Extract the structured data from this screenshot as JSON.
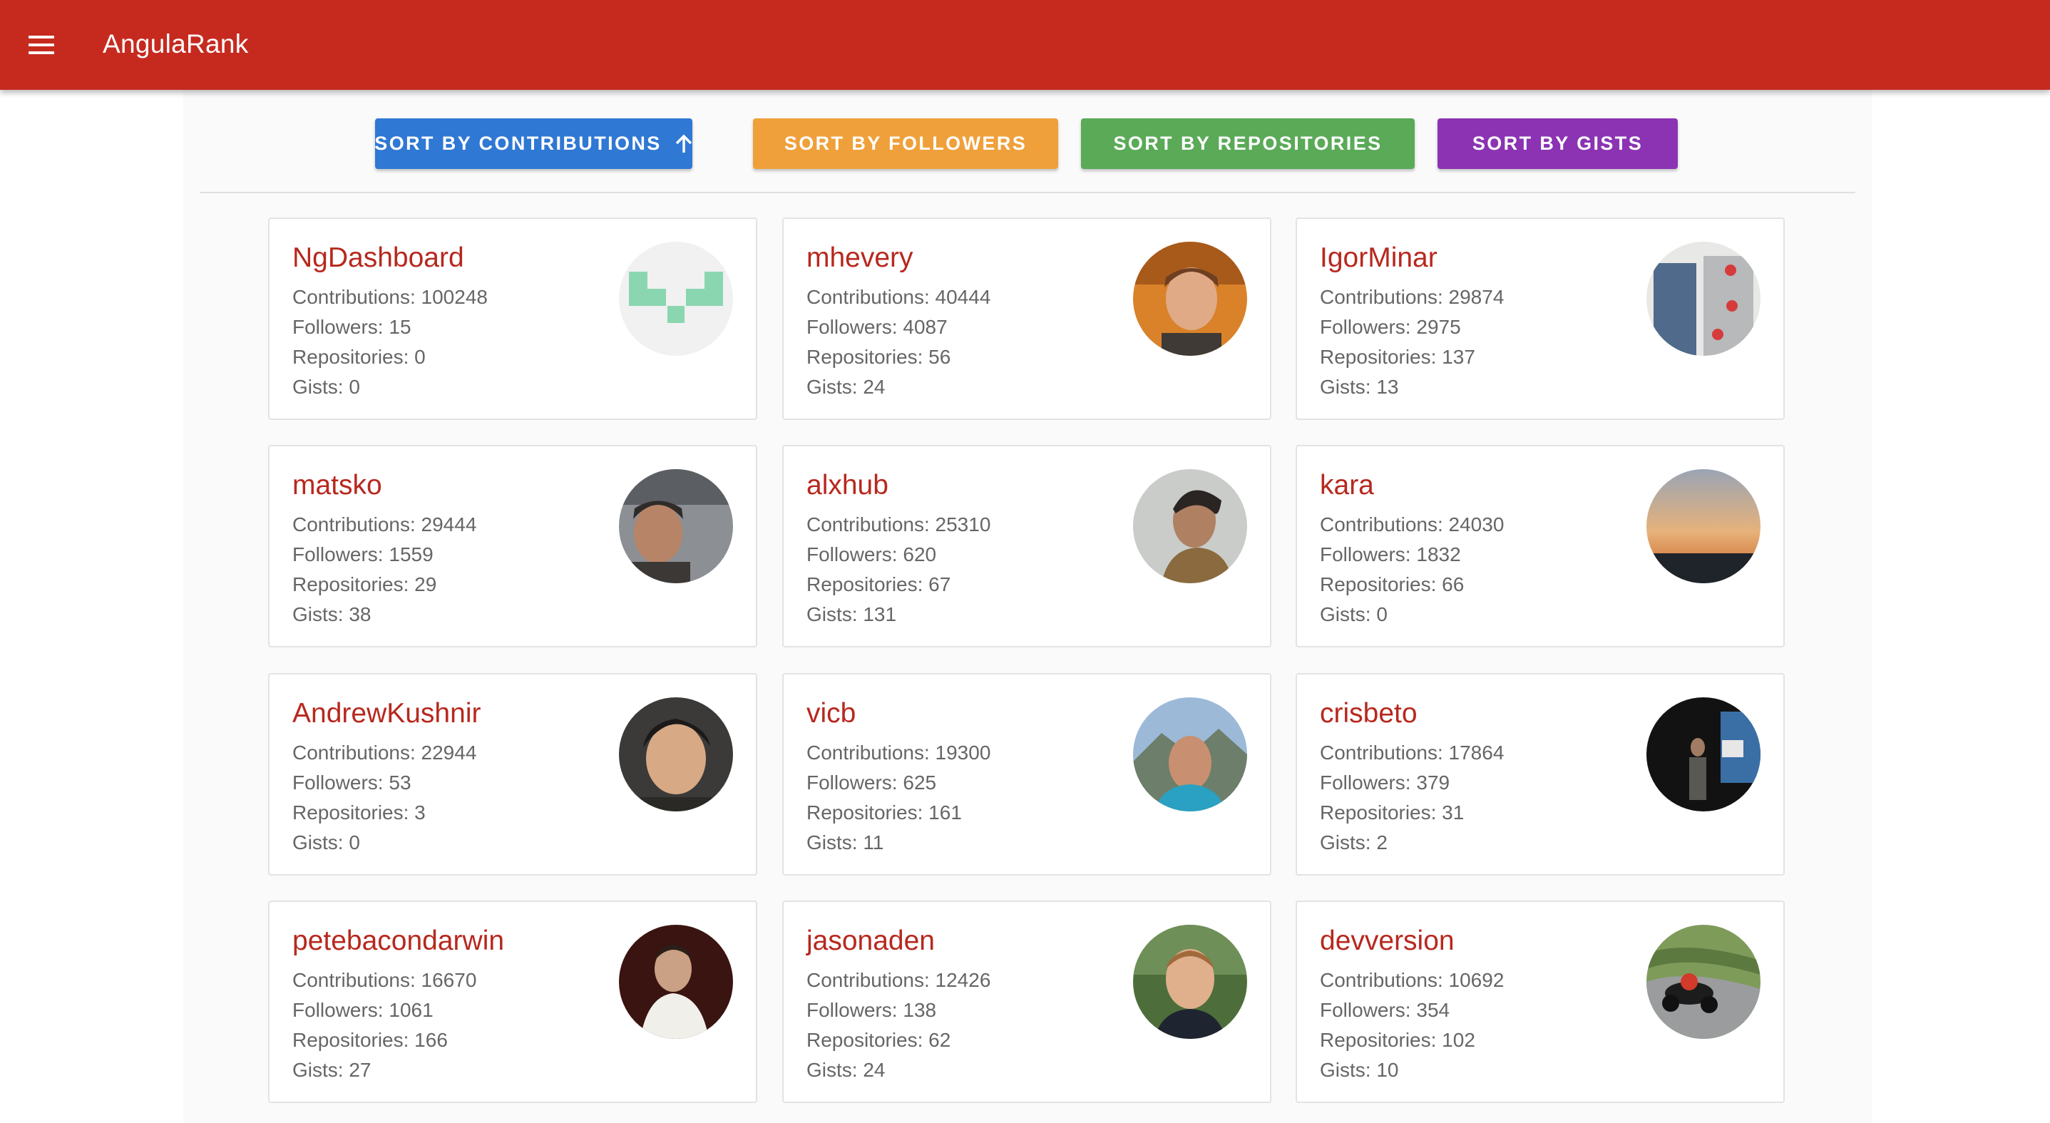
{
  "app": {
    "title": "AngulaRank",
    "menu_icon": "menu-icon"
  },
  "sort_buttons": [
    {
      "label": "SORT BY CONTRIBUTIONS",
      "color": "#2f78d4",
      "active": true,
      "icon": "arrow-up-icon"
    },
    {
      "label": "SORT BY FOLLOWERS",
      "color": "#f0a03a"
    },
    {
      "label": "SORT BY REPOSITORIES",
      "color": "#5aaa58"
    },
    {
      "label": "SORT BY GISTS",
      "color": "#8b33b3"
    }
  ],
  "colors": {
    "toolbar": "#c62a1f",
    "name": "#b7281e",
    "stat_text": "#666666"
  },
  "users": [
    {
      "name": "NgDashboard",
      "contributions": "Contributions: 100248",
      "followers": "Followers: 15",
      "repositories": "Repositories: 0",
      "gists": "Gists: 0",
      "avatar": "identicon-avatar"
    },
    {
      "name": "mhevery",
      "contributions": "Contributions: 40444",
      "followers": "Followers: 4087",
      "repositories": "Repositories: 56",
      "gists": "Gists: 24",
      "avatar": "user-photo-avatar"
    },
    {
      "name": "IgorMinar",
      "contributions": "Contributions: 29874",
      "followers": "Followers: 2975",
      "repositories": "Repositories: 137",
      "gists": "Gists: 13",
      "avatar": "user-photo-avatar"
    },
    {
      "name": "matsko",
      "contributions": "Contributions: 29444",
      "followers": "Followers: 1559",
      "repositories": "Repositories: 29",
      "gists": "Gists: 38",
      "avatar": "user-photo-avatar"
    },
    {
      "name": "alxhub",
      "contributions": "Contributions: 25310",
      "followers": "Followers: 620",
      "repositories": "Repositories: 67",
      "gists": "Gists: 131",
      "avatar": "user-photo-avatar"
    },
    {
      "name": "kara",
      "contributions": "Contributions: 24030",
      "followers": "Followers: 1832",
      "repositories": "Repositories: 66",
      "gists": "Gists: 0",
      "avatar": "sunset-photo-avatar"
    },
    {
      "name": "AndrewKushnir",
      "contributions": "Contributions: 22944",
      "followers": "Followers: 53",
      "repositories": "Repositories: 3",
      "gists": "Gists: 0",
      "avatar": "user-photo-avatar"
    },
    {
      "name": "vicb",
      "contributions": "Contributions: 19300",
      "followers": "Followers: 625",
      "repositories": "Repositories: 161",
      "gists": "Gists: 11",
      "avatar": "user-photo-avatar"
    },
    {
      "name": "crisbeto",
      "contributions": "Contributions: 17864",
      "followers": "Followers: 379",
      "repositories": "Repositories: 31",
      "gists": "Gists: 2",
      "avatar": "user-photo-avatar"
    },
    {
      "name": "petebacondarwin",
      "contributions": "Contributions: 16670",
      "followers": "Followers: 1061",
      "repositories": "Repositories: 166",
      "gists": "Gists: 27",
      "avatar": "user-photo-avatar"
    },
    {
      "name": "jasonaden",
      "contributions": "Contributions: 12426",
      "followers": "Followers: 138",
      "repositories": "Repositories: 62",
      "gists": "Gists: 24",
      "avatar": "user-photo-avatar"
    },
    {
      "name": "devversion",
      "contributions": "Contributions: 10692",
      "followers": "Followers: 354",
      "repositories": "Repositories: 102",
      "gists": "Gists: 10",
      "avatar": "motorcycle-photo-avatar"
    }
  ]
}
